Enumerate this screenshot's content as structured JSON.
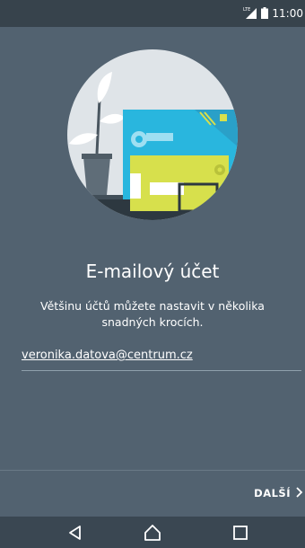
{
  "status_bar": {
    "time": "11:00",
    "network_type": "LTE",
    "icons": [
      "signal-icon",
      "battery-icon"
    ]
  },
  "main": {
    "title": "E-mailový účet",
    "subtitle": "Většinu účtů můžete nastavit v několika snadných krocích.",
    "email_value": "veronika.datova@centrum.cz"
  },
  "footer": {
    "next_label": "DALŠÍ",
    "next_icon": "chevron-right-icon"
  },
  "nav_bar": {
    "icons": [
      "back-icon",
      "home-icon",
      "recents-icon"
    ]
  },
  "colors": {
    "background": "#526270",
    "status_bar": "#37434c",
    "nav_bar": "#3a4752",
    "illustration_circle": "#dfe4e8",
    "envelope_blue": "#29b6de",
    "envelope_yellow": "#d7e04c"
  }
}
